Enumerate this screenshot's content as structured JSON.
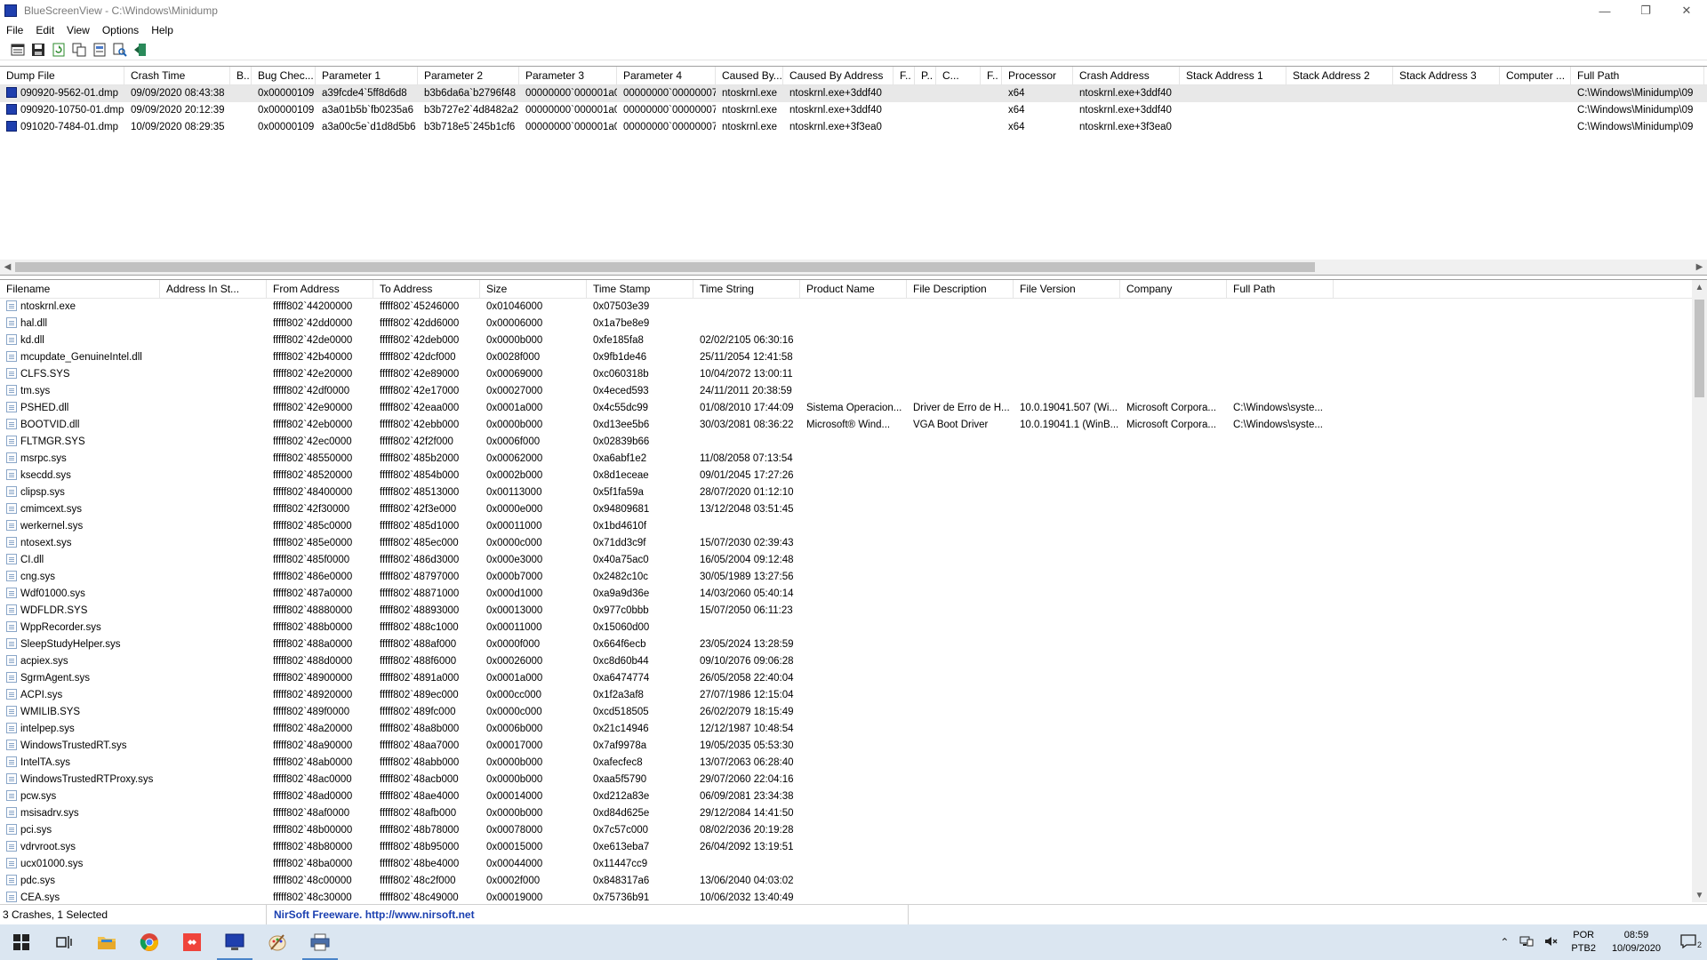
{
  "window": {
    "app_name": "BlueScreenView",
    "path": "C:\\Windows\\Minidump",
    "minimize": "—",
    "restore": "❐",
    "close": "✕"
  },
  "menu": [
    "File",
    "Edit",
    "View",
    "Options",
    "Help"
  ],
  "toolbar": {
    "buttons": [
      "properties-icon",
      "save-icon",
      "refresh-icon",
      "copy-icon",
      "html-report-icon",
      "find-icon",
      "exit-icon"
    ]
  },
  "crash_table": {
    "columns": [
      {
        "label": "Dump File",
        "w": 140
      },
      {
        "label": "Crash Time",
        "w": 119
      },
      {
        "label": "B..",
        "w": 24
      },
      {
        "label": "Bug Chec...",
        "w": 72
      },
      {
        "label": "Parameter 1",
        "w": 115
      },
      {
        "label": "Parameter 2",
        "w": 114
      },
      {
        "label": "Parameter 3",
        "w": 110
      },
      {
        "label": "Parameter 4",
        "w": 111
      },
      {
        "label": "Caused By...",
        "w": 76
      },
      {
        "label": "Caused By Address",
        "w": 124
      },
      {
        "label": "F..",
        "w": 24
      },
      {
        "label": "P..",
        "w": 24
      },
      {
        "label": "C...",
        "w": 50
      },
      {
        "label": "F..",
        "w": 24
      },
      {
        "label": "Processor",
        "w": 80
      },
      {
        "label": "Crash Address",
        "w": 120
      },
      {
        "label": "Stack Address 1",
        "w": 120
      },
      {
        "label": "Stack Address 2",
        "w": 120
      },
      {
        "label": "Stack Address 3",
        "w": 120
      },
      {
        "label": "Computer ...",
        "w": 80
      },
      {
        "label": "Full Path",
        "w": 150
      }
    ],
    "rows": [
      [
        "090920-9562-01.dmp",
        "09/09/2020 08:43:38",
        "",
        "0x00000109",
        "a39fcde4`5ff8d6d8",
        "b3b6da6a`b2796f48",
        "00000000`000001a0",
        "00000000`00000007",
        "ntoskrnl.exe",
        "ntoskrnl.exe+3ddf40",
        "",
        "",
        "",
        "",
        "x64",
        "ntoskrnl.exe+3ddf40",
        "",
        "",
        "",
        "",
        "C:\\Windows\\Minidump\\09"
      ],
      [
        "090920-10750-01.dmp",
        "09/09/2020 20:12:39",
        "",
        "0x00000109",
        "a3a01b5b`fb0235a6",
        "b3b727e2`4d8482a2",
        "00000000`000001a0",
        "00000000`00000007",
        "ntoskrnl.exe",
        "ntoskrnl.exe+3ddf40",
        "",
        "",
        "",
        "",
        "x64",
        "ntoskrnl.exe+3ddf40",
        "",
        "",
        "",
        "",
        "C:\\Windows\\Minidump\\09"
      ],
      [
        "091020-7484-01.dmp",
        "10/09/2020 08:29:35",
        "",
        "0x00000109",
        "a3a00c5e`d1d8d5b6",
        "b3b718e5`245b1cf6",
        "00000000`000001a0",
        "00000000`00000007",
        "ntoskrnl.exe",
        "ntoskrnl.exe+3f3ea0",
        "",
        "",
        "",
        "",
        "x64",
        "ntoskrnl.exe+3f3ea0",
        "",
        "",
        "",
        "",
        "C:\\Windows\\Minidump\\09"
      ]
    ]
  },
  "driver_table": {
    "columns": [
      {
        "label": "Filename",
        "w": 180
      },
      {
        "label": "Address In St...",
        "w": 120
      },
      {
        "label": "From Address",
        "w": 120
      },
      {
        "label": "To Address",
        "w": 120
      },
      {
        "label": "Size",
        "w": 120
      },
      {
        "label": "Time Stamp",
        "w": 120
      },
      {
        "label": "Time String",
        "w": 120
      },
      {
        "label": "Product Name",
        "w": 120
      },
      {
        "label": "File Description",
        "w": 120
      },
      {
        "label": "File Version",
        "w": 120
      },
      {
        "label": "Company",
        "w": 120
      },
      {
        "label": "Full Path",
        "w": 120
      }
    ],
    "rows": [
      [
        "ntoskrnl.exe",
        "",
        "fffff802`44200000",
        "fffff802`45246000",
        "0x01046000",
        "0x07503e39",
        "",
        "",
        "",
        "",
        "",
        ""
      ],
      [
        "hal.dll",
        "",
        "fffff802`42dd0000",
        "fffff802`42dd6000",
        "0x00006000",
        "0x1a7be8e9",
        "",
        "",
        "",
        "",
        "",
        ""
      ],
      [
        "kd.dll",
        "",
        "fffff802`42de0000",
        "fffff802`42deb000",
        "0x0000b000",
        "0xfe185fa8",
        "02/02/2105 06:30:16",
        "",
        "",
        "",
        "",
        ""
      ],
      [
        "mcupdate_GenuineIntel.dll",
        "",
        "fffff802`42b40000",
        "fffff802`42dcf000",
        "0x0028f000",
        "0x9fb1de46",
        "25/11/2054 12:41:58",
        "",
        "",
        "",
        "",
        ""
      ],
      [
        "CLFS.SYS",
        "",
        "fffff802`42e20000",
        "fffff802`42e89000",
        "0x00069000",
        "0xc060318b",
        "10/04/2072 13:00:11",
        "",
        "",
        "",
        "",
        ""
      ],
      [
        "tm.sys",
        "",
        "fffff802`42df0000",
        "fffff802`42e17000",
        "0x00027000",
        "0x4eced593",
        "24/11/2011 20:38:59",
        "",
        "",
        "",
        "",
        ""
      ],
      [
        "PSHED.dll",
        "",
        "fffff802`42e90000",
        "fffff802`42eaa000",
        "0x0001a000",
        "0x4c55dc99",
        "01/08/2010 17:44:09",
        "Sistema Operacion...",
        "Driver de Erro de H...",
        "10.0.19041.507 (Wi...",
        "Microsoft Corpora...",
        "C:\\Windows\\syste..."
      ],
      [
        "BOOTVID.dll",
        "",
        "fffff802`42eb0000",
        "fffff802`42ebb000",
        "0x0000b000",
        "0xd13ee5b6",
        "30/03/2081 08:36:22",
        "Microsoft® Wind...",
        "VGA Boot Driver",
        "10.0.19041.1 (WinB...",
        "Microsoft Corpora...",
        "C:\\Windows\\syste..."
      ],
      [
        "FLTMGR.SYS",
        "",
        "fffff802`42ec0000",
        "fffff802`42f2f000",
        "0x0006f000",
        "0x02839b66",
        "",
        "",
        "",
        "",
        "",
        ""
      ],
      [
        "msrpc.sys",
        "",
        "fffff802`48550000",
        "fffff802`485b2000",
        "0x00062000",
        "0xa6abf1e2",
        "11/08/2058 07:13:54",
        "",
        "",
        "",
        "",
        ""
      ],
      [
        "ksecdd.sys",
        "",
        "fffff802`48520000",
        "fffff802`4854b000",
        "0x0002b000",
        "0x8d1eceae",
        "09/01/2045 17:27:26",
        "",
        "",
        "",
        "",
        ""
      ],
      [
        "clipsp.sys",
        "",
        "fffff802`48400000",
        "fffff802`48513000",
        "0x00113000",
        "0x5f1fa59a",
        "28/07/2020 01:12:10",
        "",
        "",
        "",
        "",
        ""
      ],
      [
        "cmimcext.sys",
        "",
        "fffff802`42f30000",
        "fffff802`42f3e000",
        "0x0000e000",
        "0x94809681",
        "13/12/2048 03:51:45",
        "",
        "",
        "",
        "",
        ""
      ],
      [
        "werkernel.sys",
        "",
        "fffff802`485c0000",
        "fffff802`485d1000",
        "0x00011000",
        "0x1bd4610f",
        "",
        "",
        "",
        "",
        "",
        ""
      ],
      [
        "ntosext.sys",
        "",
        "fffff802`485e0000",
        "fffff802`485ec000",
        "0x0000c000",
        "0x71dd3c9f",
        "15/07/2030 02:39:43",
        "",
        "",
        "",
        "",
        ""
      ],
      [
        "CI.dll",
        "",
        "fffff802`485f0000",
        "fffff802`486d3000",
        "0x000e3000",
        "0x40a75ac0",
        "16/05/2004 09:12:48",
        "",
        "",
        "",
        "",
        ""
      ],
      [
        "cng.sys",
        "",
        "fffff802`486e0000",
        "fffff802`48797000",
        "0x000b7000",
        "0x2482c10c",
        "30/05/1989 13:27:56",
        "",
        "",
        "",
        "",
        ""
      ],
      [
        "Wdf01000.sys",
        "",
        "fffff802`487a0000",
        "fffff802`48871000",
        "0x000d1000",
        "0xa9a9d36e",
        "14/03/2060 05:40:14",
        "",
        "",
        "",
        "",
        ""
      ],
      [
        "WDFLDR.SYS",
        "",
        "fffff802`48880000",
        "fffff802`48893000",
        "0x00013000",
        "0x977c0bbb",
        "15/07/2050 06:11:23",
        "",
        "",
        "",
        "",
        ""
      ],
      [
        "WppRecorder.sys",
        "",
        "fffff802`488b0000",
        "fffff802`488c1000",
        "0x00011000",
        "0x15060d00",
        "",
        "",
        "",
        "",
        "",
        ""
      ],
      [
        "SleepStudyHelper.sys",
        "",
        "fffff802`488a0000",
        "fffff802`488af000",
        "0x0000f000",
        "0x664f6ecb",
        "23/05/2024 13:28:59",
        "",
        "",
        "",
        "",
        ""
      ],
      [
        "acpiex.sys",
        "",
        "fffff802`488d0000",
        "fffff802`488f6000",
        "0x00026000",
        "0xc8d60b44",
        "09/10/2076 09:06:28",
        "",
        "",
        "",
        "",
        ""
      ],
      [
        "SgrmAgent.sys",
        "",
        "fffff802`48900000",
        "fffff802`4891a000",
        "0x0001a000",
        "0xa6474774",
        "26/05/2058 22:40:04",
        "",
        "",
        "",
        "",
        ""
      ],
      [
        "ACPI.sys",
        "",
        "fffff802`48920000",
        "fffff802`489ec000",
        "0x000cc000",
        "0x1f2a3af8",
        "27/07/1986 12:15:04",
        "",
        "",
        "",
        "",
        ""
      ],
      [
        "WMILIB.SYS",
        "",
        "fffff802`489f0000",
        "fffff802`489fc000",
        "0x0000c000",
        "0xcd518505",
        "26/02/2079 18:15:49",
        "",
        "",
        "",
        "",
        ""
      ],
      [
        "intelpep.sys",
        "",
        "fffff802`48a20000",
        "fffff802`48a8b000",
        "0x0006b000",
        "0x21c14946",
        "12/12/1987 10:48:54",
        "",
        "",
        "",
        "",
        ""
      ],
      [
        "WindowsTrustedRT.sys",
        "",
        "fffff802`48a90000",
        "fffff802`48aa7000",
        "0x00017000",
        "0x7af9978a",
        "19/05/2035 05:53:30",
        "",
        "",
        "",
        "",
        ""
      ],
      [
        "IntelTA.sys",
        "",
        "fffff802`48ab0000",
        "fffff802`48abb000",
        "0x0000b000",
        "0xafecfec8",
        "13/07/2063 06:28:40",
        "",
        "",
        "",
        "",
        ""
      ],
      [
        "WindowsTrustedRTProxy.sys",
        "",
        "fffff802`48ac0000",
        "fffff802`48acb000",
        "0x0000b000",
        "0xaa5f5790",
        "29/07/2060 22:04:16",
        "",
        "",
        "",
        "",
        ""
      ],
      [
        "pcw.sys",
        "",
        "fffff802`48ad0000",
        "fffff802`48ae4000",
        "0x00014000",
        "0xd212a83e",
        "06/09/2081 23:34:38",
        "",
        "",
        "",
        "",
        ""
      ],
      [
        "msisadrv.sys",
        "",
        "fffff802`48af0000",
        "fffff802`48afb000",
        "0x0000b000",
        "0xd84d625e",
        "29/12/2084 14:41:50",
        "",
        "",
        "",
        "",
        ""
      ],
      [
        "pci.sys",
        "",
        "fffff802`48b00000",
        "fffff802`48b78000",
        "0x00078000",
        "0x7c57c000",
        "08/02/2036 20:19:28",
        "",
        "",
        "",
        "",
        ""
      ],
      [
        "vdrvroot.sys",
        "",
        "fffff802`48b80000",
        "fffff802`48b95000",
        "0x00015000",
        "0xe613eba7",
        "26/04/2092 13:19:51",
        "",
        "",
        "",
        "",
        ""
      ],
      [
        "ucx01000.sys",
        "",
        "fffff802`48ba0000",
        "fffff802`48be4000",
        "0x00044000",
        "0x11447cc9",
        "",
        "",
        "",
        "",
        "",
        ""
      ],
      [
        "pdc.sys",
        "",
        "fffff802`48c00000",
        "fffff802`48c2f000",
        "0x0002f000",
        "0x848317a6",
        "13/06/2040 04:03:02",
        "",
        "",
        "",
        "",
        ""
      ],
      [
        "CEA.sys",
        "",
        "fffff802`48c30000",
        "fffff802`48c49000",
        "0x00019000",
        "0x75736b91",
        "10/06/2032 13:40:49",
        "",
        "",
        "",
        "",
        ""
      ]
    ]
  },
  "status": {
    "summary": "3 Crashes, 1 Selected",
    "nirsoft": "NirSoft Freeware.  http://www.nirsoft.net"
  },
  "taskbar": {
    "apps": [
      "windows-start-icon",
      "task-view-icon",
      "file-explorer-icon",
      "chrome-icon",
      "anydesk-icon",
      "bluescreenview-icon",
      "paint-icon",
      "print-app-icon"
    ],
    "lang_top": "POR",
    "lang_bottom": "PTB2",
    "time": "08:59",
    "date": "10/09/2020",
    "notif_count": "2"
  }
}
